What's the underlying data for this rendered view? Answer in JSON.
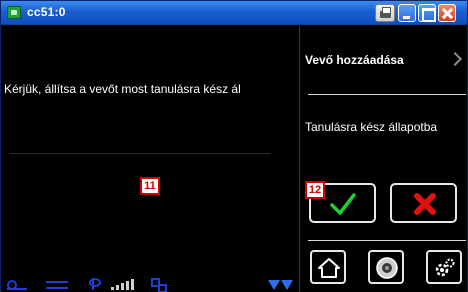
{
  "window": {
    "title": "cc51:0",
    "icons": {
      "app": "app-icon",
      "printer": "printer-icon",
      "minimize": "minimize-icon",
      "maximize": "maximize-icon",
      "close": "close-icon"
    }
  },
  "left_pane": {
    "message": "Kérjük, állítsa a vevőt most tanulásra kész ál",
    "badge": "11",
    "status_icons": [
      "power-plug-icon",
      "link-icon",
      "antenna-icon",
      "signal-strength-icon",
      "network-icon",
      "scroll-down-arrows-icon"
    ]
  },
  "right_pane": {
    "title": "Vevő hozzáadása",
    "status_text": "Tanulásra kész állapotba",
    "badge": "12",
    "confirm_icon": "checkmark-icon",
    "cancel_icon": "cross-icon",
    "nav_icons": [
      "home-icon",
      "camera-icon",
      "settings-icon"
    ]
  },
  "colors": {
    "titlebar": "#1a5fd0",
    "background": "#000000",
    "text": "#ffffff",
    "badge": "#d00000",
    "confirm": "#1fcf2a",
    "cancel": "#e31010",
    "status_icons": "#1c3fd8"
  }
}
